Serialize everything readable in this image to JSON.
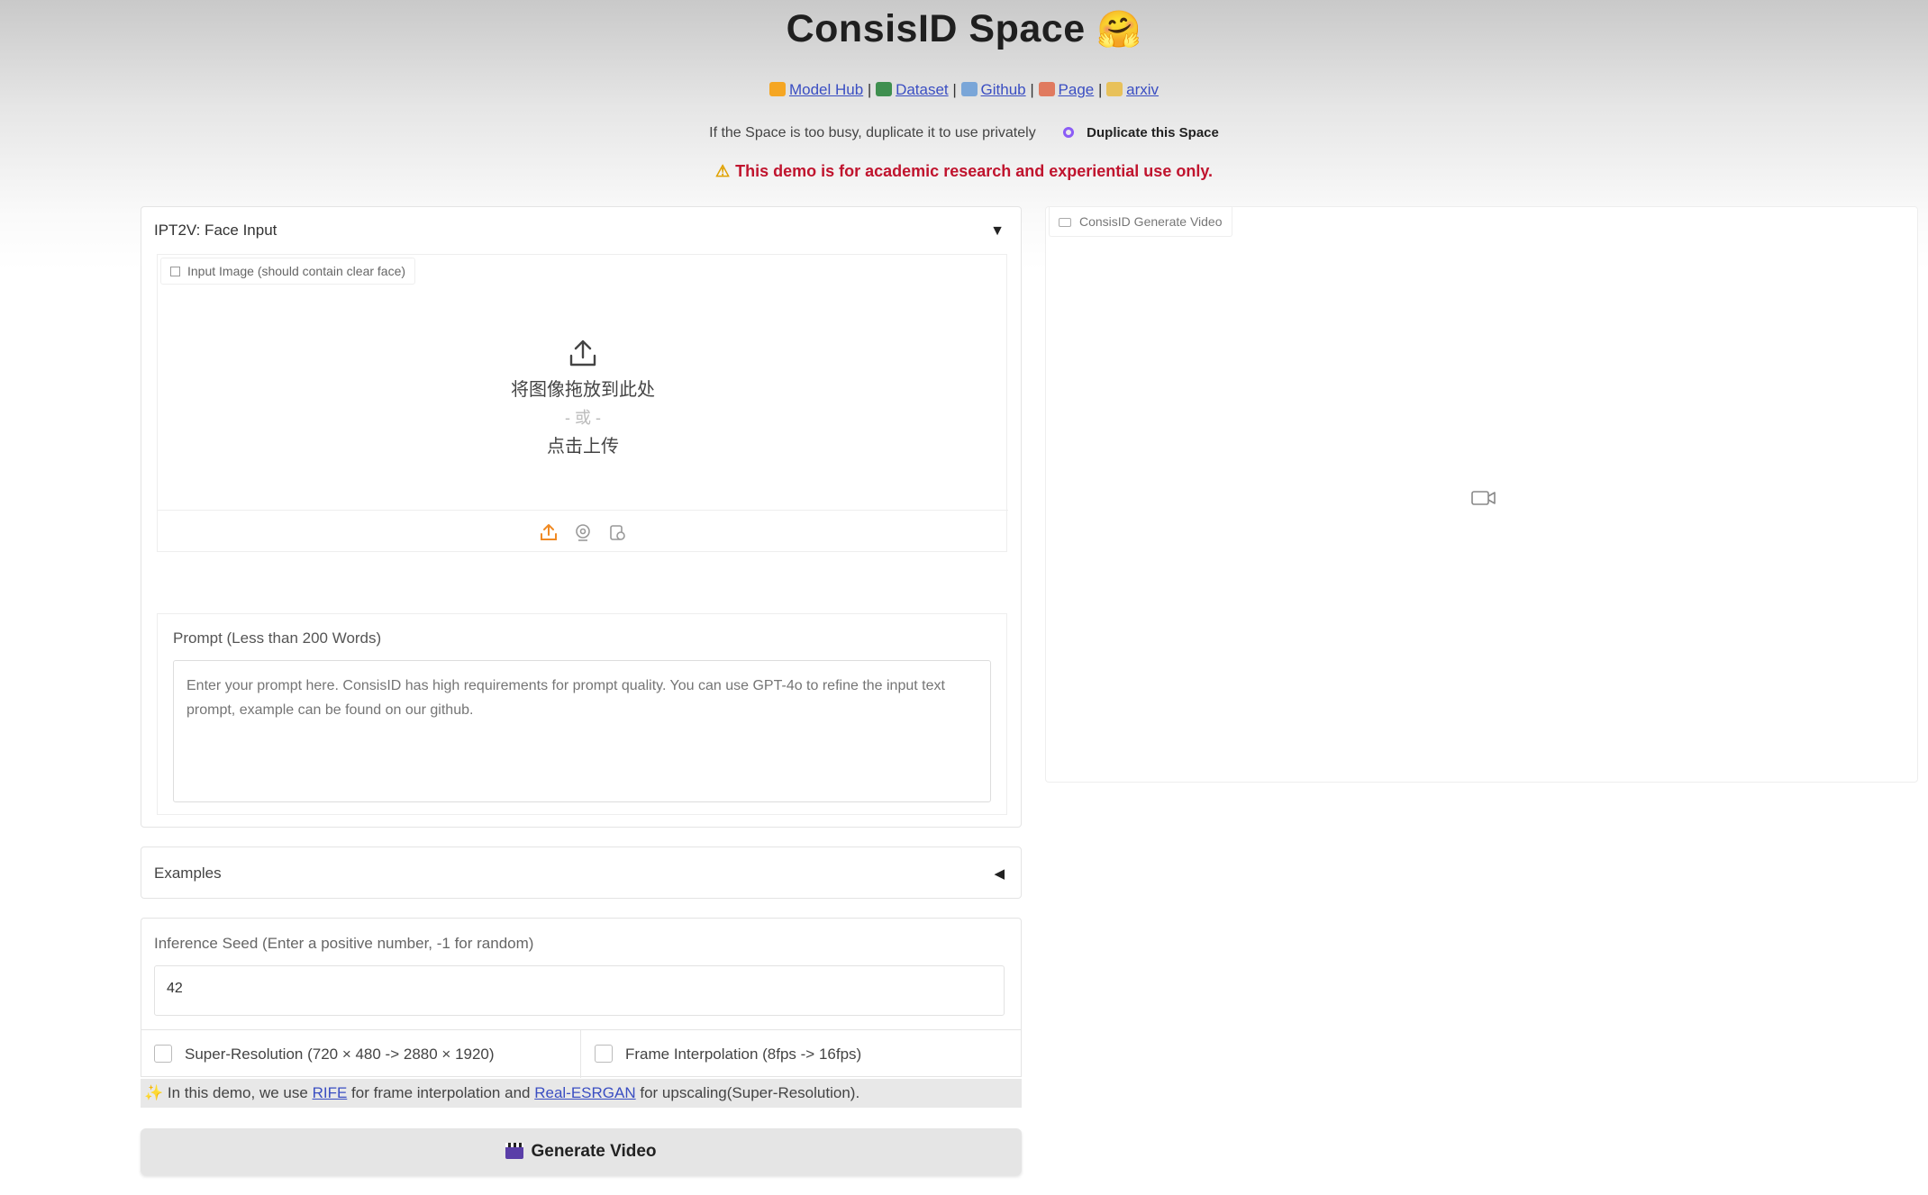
{
  "header": {
    "title": "ConsisID Space",
    "title_emoji": "🤗",
    "links": [
      {
        "label": "Model Hub",
        "icon_color": "#f5a623"
      },
      {
        "label": "Dataset",
        "icon_color": "#3f8f4f"
      },
      {
        "label": "Github",
        "icon_color": "#7aa6d8"
      },
      {
        "label": "Page",
        "icon_color": "#e07a5f"
      },
      {
        "label": "arxiv",
        "icon_color": "#e8c15a"
      }
    ],
    "separator": "|",
    "busy_text": "If the Space is too busy, duplicate it to use privately",
    "duplicate_label": "Duplicate this Space",
    "warning": "This demo is for academic research and experiential use only."
  },
  "face_input": {
    "accordion_label": "IPT2V: Face Input",
    "accordion_arrow": "▼",
    "image_label": "Input Image (should contain clear face)",
    "drop_text": "将图像拖放到此处",
    "or_text": "- 或 -",
    "click_text": "点击上传",
    "tools": [
      "upload-icon",
      "webcam-icon",
      "clipboard-icon"
    ],
    "prompt_label": "Prompt (Less than 200 Words)",
    "prompt_placeholder": "Enter your prompt here. ConsisID has high requirements for prompt quality. You can use GPT-4o to refine the input text prompt, example can be found on our github."
  },
  "examples": {
    "label": "Examples",
    "arrow": "◀"
  },
  "seed": {
    "label": "Inference Seed (Enter a positive number, -1 for random)",
    "value": "42"
  },
  "options": {
    "super_resolution": {
      "label": "Super-Resolution (720 × 480 -> 2880 × 1920)",
      "checked": false
    },
    "frame_interpolation": {
      "label": "Frame Interpolation (8fps -> 16fps)",
      "checked": false
    }
  },
  "info": {
    "spark": "✨",
    "prefix": "In this demo, we use",
    "rife": "RIFE",
    "middle": "for frame interpolation and",
    "esrgan": "Real-ESRGAN",
    "suffix": "for upscaling(Super-Resolution)."
  },
  "generate_button": "Generate Video",
  "video": {
    "label": "ConsisID Generate Video"
  }
}
